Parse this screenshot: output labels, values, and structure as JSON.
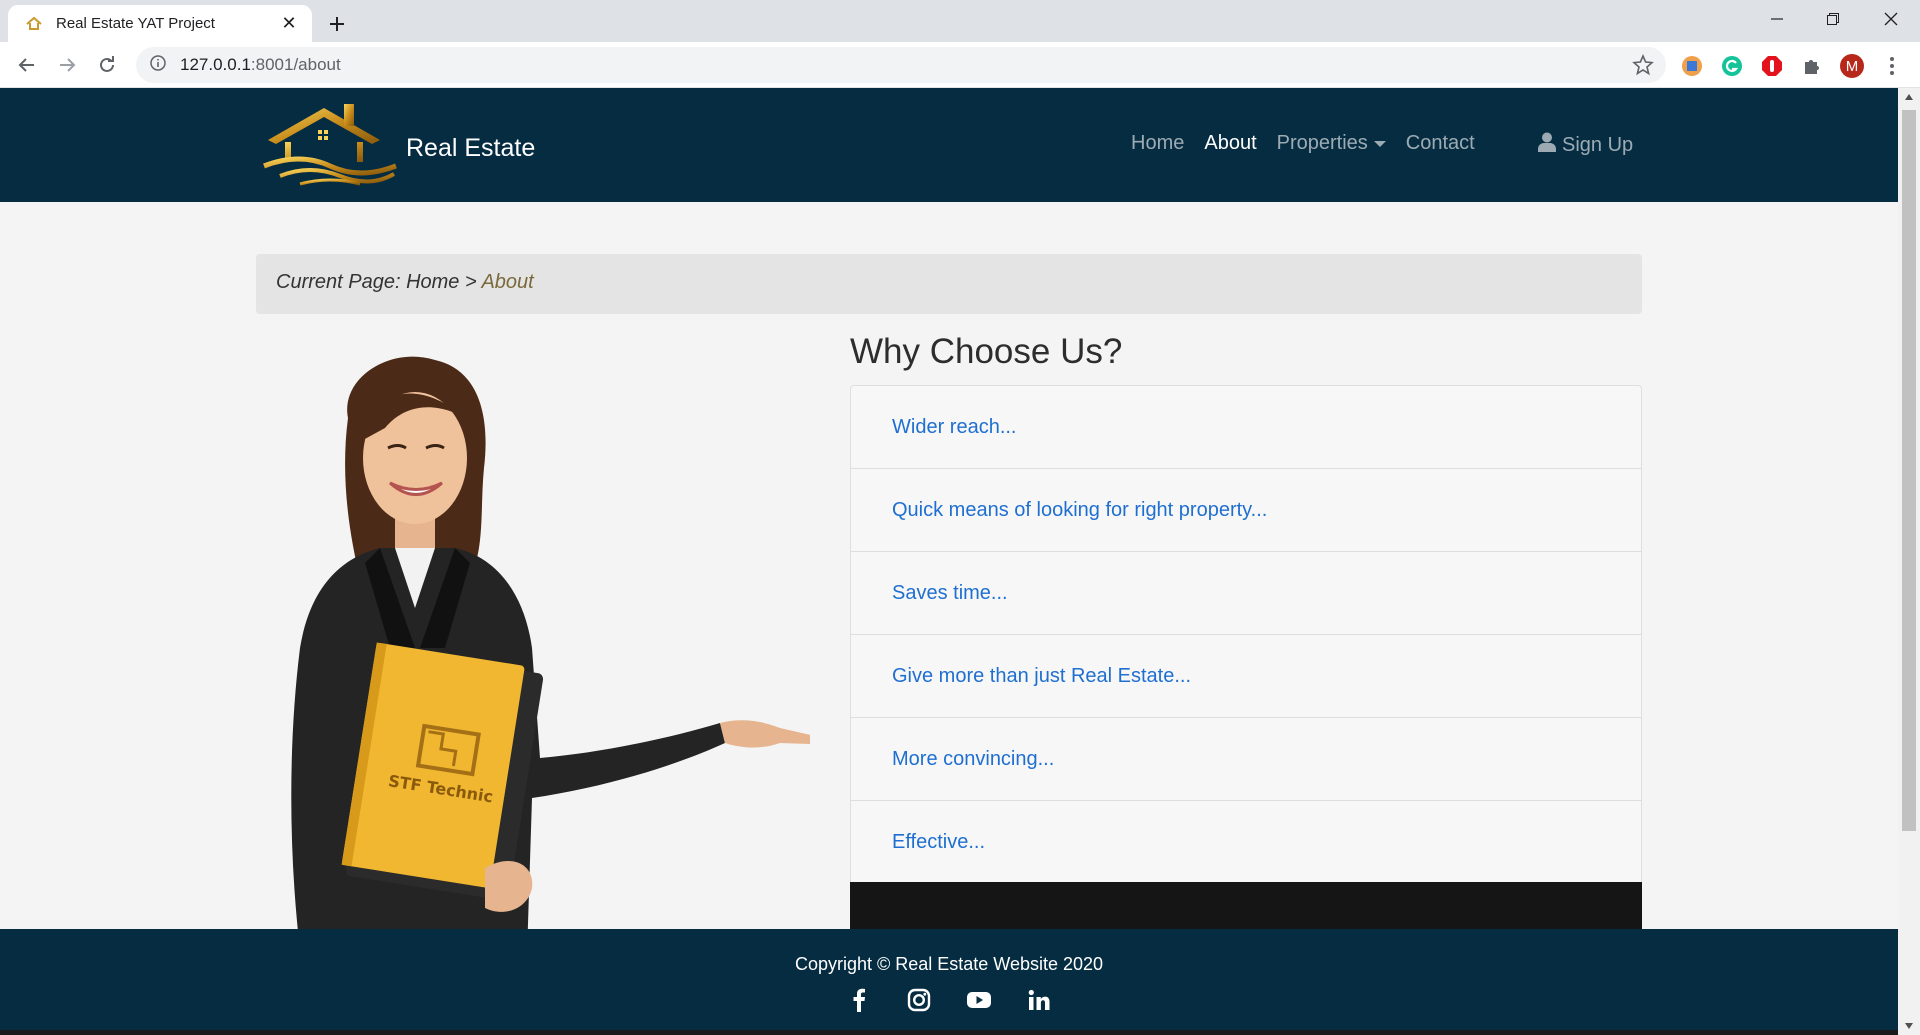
{
  "browser": {
    "tab_title": "Real Estate YAT Project",
    "url_host": "127.0.0.1",
    "url_path": ":8001/about",
    "profile_initial": "M"
  },
  "navbar": {
    "brand": "Real Estate",
    "links": [
      "Home",
      "About",
      "Properties",
      "Contact"
    ],
    "active": "About",
    "signup": "Sign Up"
  },
  "breadcrumb": {
    "prefix": "Current Page: Home > ",
    "current": "About"
  },
  "why": {
    "title": "Why Choose Us?",
    "items": [
      "Wider reach...",
      "Quick means of looking for right property...",
      "Saves time...",
      "Give more than just Real Estate...",
      "More convincing...",
      "Effective..."
    ]
  },
  "footer": {
    "copyright": "Copyright © Real Estate Website 2020",
    "social": [
      "facebook-icon",
      "instagram-icon",
      "youtube-icon",
      "linkedin-icon"
    ]
  },
  "folder_logo": "STF Technic",
  "colors": {
    "navbar_bg": "#062c41",
    "link_blue": "#1f6fd1",
    "breadcrumb_current": "#7a6a3b"
  }
}
